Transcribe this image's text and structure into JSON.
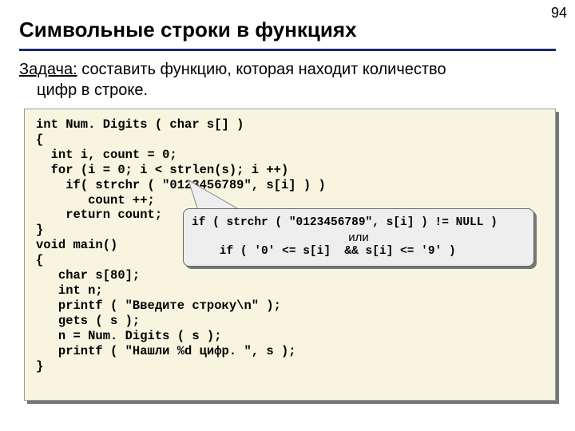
{
  "page_number": "94",
  "heading": "Символьные строки в функциях",
  "task": {
    "label": "Задача:",
    "line1": " составить функцию, которая находит количество",
    "line2": "цифр в строке."
  },
  "code": "int Num. Digits ( char s[] )\n{\n  int i, count = 0;\n  for (i = 0; i < strlen(s); i ++)\n    if( strchr ( \"0123456789\", s[i] ) )\n       count ++;\n    return count;\n}\nvoid main()\n{\n   char s[80];\n   int n;\n   printf ( \"Введите строку\\n\" );\n   gets ( s );\n   n = Num. Digits ( s );\n   printf ( \"Нашли %d цифр. \", s );\n}",
  "callout": {
    "line1": "if ( strchr ( \"0123456789\", s[i] ) != NULL )",
    "or": "или",
    "line2": "    if ( '0' <= s[i]  && s[i] <= '9' )"
  }
}
